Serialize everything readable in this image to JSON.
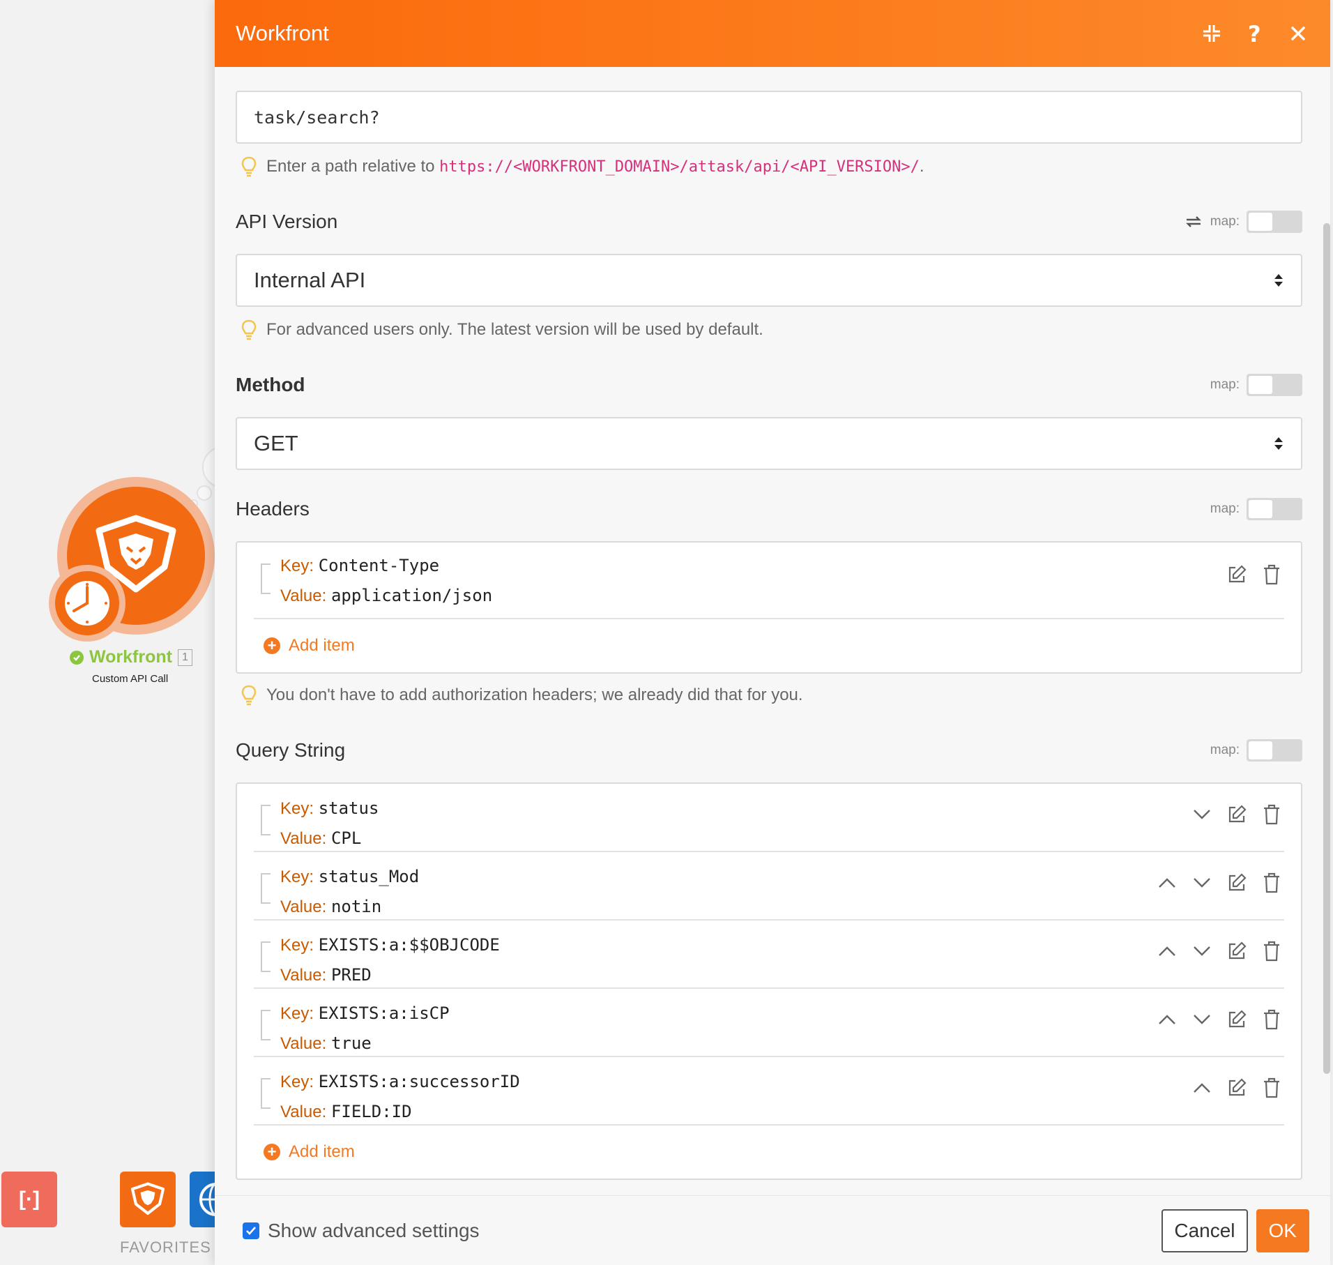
{
  "module": {
    "name": "Workfront",
    "count": "1",
    "subtitle": "Custom API Call"
  },
  "toolbar": {
    "json_tool": "[·]",
    "favorites": "FAVORITES"
  },
  "dialog": {
    "title": "Workfront",
    "url_value": "task/search?",
    "url_hint_prefix": "Enter a path relative to",
    "url_hint_link": "https://<WORKFRONT_DOMAIN>/attask/api/<API_VERSION>/",
    "url_hint_suffix": ".",
    "map_label": "map:",
    "api_version": {
      "label": "API Version",
      "value": "Internal API",
      "hint": "For advanced users only. The latest version will be used by default."
    },
    "method": {
      "label": "Method",
      "value": "GET"
    },
    "headers": {
      "label": "Headers",
      "items": [
        {
          "key_label": "Key:",
          "key": "Content-Type",
          "value_label": "Value:",
          "value": "application/json"
        }
      ],
      "add_item": "Add item",
      "hint": "You don't have to add authorization headers; we already did that for you."
    },
    "query_string": {
      "label": "Query String",
      "items": [
        {
          "key_label": "Key:",
          "key": "status",
          "value_label": "Value:",
          "value": "CPL"
        },
        {
          "key_label": "Key:",
          "key": "status_Mod",
          "value_label": "Value:",
          "value": "notin"
        },
        {
          "key_label": "Key:",
          "key": "EXISTS:a:$$OBJCODE",
          "value_label": "Value:",
          "value": "PRED"
        },
        {
          "key_label": "Key:",
          "key": "EXISTS:a:isCP",
          "value_label": "Value:",
          "value": "true"
        },
        {
          "key_label": "Key:",
          "key": "EXISTS:a:successorID",
          "value_label": "Value:",
          "value": "FIELD:ID"
        }
      ],
      "add_item": "Add item"
    },
    "footer": {
      "advanced_label": "Show advanced settings",
      "advanced_checked": true,
      "cancel": "Cancel",
      "ok": "OK"
    }
  },
  "colors": {
    "accent": "#f47920",
    "header_start": "#fb6a0c",
    "header_end": "#fd8a2a",
    "key_label": "#c85a00",
    "link": "#d6307d",
    "success": "#8cc63f"
  }
}
